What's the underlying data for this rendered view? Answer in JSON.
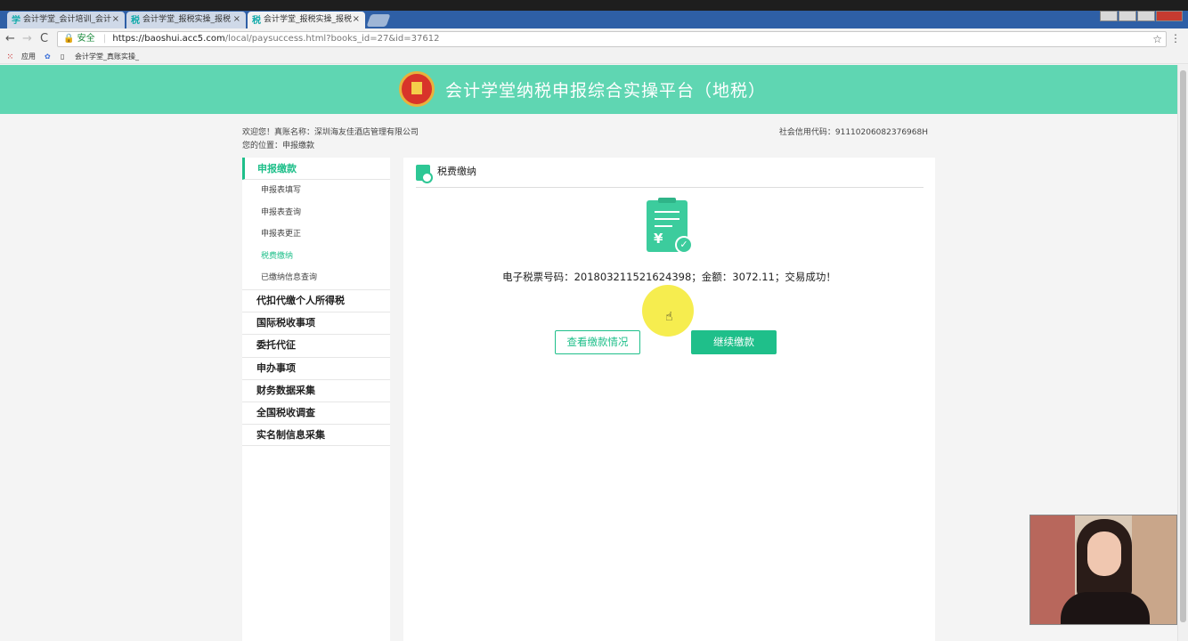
{
  "browser": {
    "tabs": [
      {
        "icon": "学",
        "label": "会计学堂_会计培训_会计",
        "close": "×"
      },
      {
        "icon": "税",
        "label": "会计学堂_报税实操_报税",
        "close": "×"
      },
      {
        "icon": "税",
        "label": "会计学堂_报税实操_报税",
        "close": "×"
      }
    ],
    "nav": {
      "back": "←",
      "forward": "→",
      "reload": "C"
    },
    "address": {
      "lock": "🔒",
      "secure": "安全",
      "sep": "|",
      "url_host": "https://baoshui.acc5.com",
      "url_path": "/local/paysuccess.html?books_id=27&id=37612",
      "star": "☆"
    },
    "menu_dots": "⋮",
    "bookmarks": {
      "apps": "应用",
      "item": "会计学堂_真账实操_"
    }
  },
  "header": {
    "title": "会计学堂纳税申报综合实操平台（地税）"
  },
  "info": {
    "welcome": "欢迎您！真账名称：深圳海友佳酒店管理有限公司",
    "location": "您的位置：申报缴款",
    "credit": "社会信用代码：91110206082376968H"
  },
  "sidebar": {
    "head": "申报缴款",
    "subs": [
      "申报表填写",
      "申报表查询",
      "申报表更正",
      "税费缴纳",
      "已缴纳信息查询"
    ],
    "groups": [
      "代扣代缴个人所得税",
      "国际税收事项",
      "委托代征",
      "申办事项",
      "财务数据采集",
      "全国税收调查",
      "实名制信息采集"
    ]
  },
  "main": {
    "title": "税费缴纳",
    "receipt_yen": "¥",
    "receipt_check": "✓",
    "result": "电子税票号码：201803211521624398；金额：3072.11；交易成功！",
    "btn_view": "查看缴款情况",
    "btn_continue": "继续缴款"
  },
  "colors": {
    "accent": "#1fbf8a",
    "header": "#5fd6b2"
  }
}
